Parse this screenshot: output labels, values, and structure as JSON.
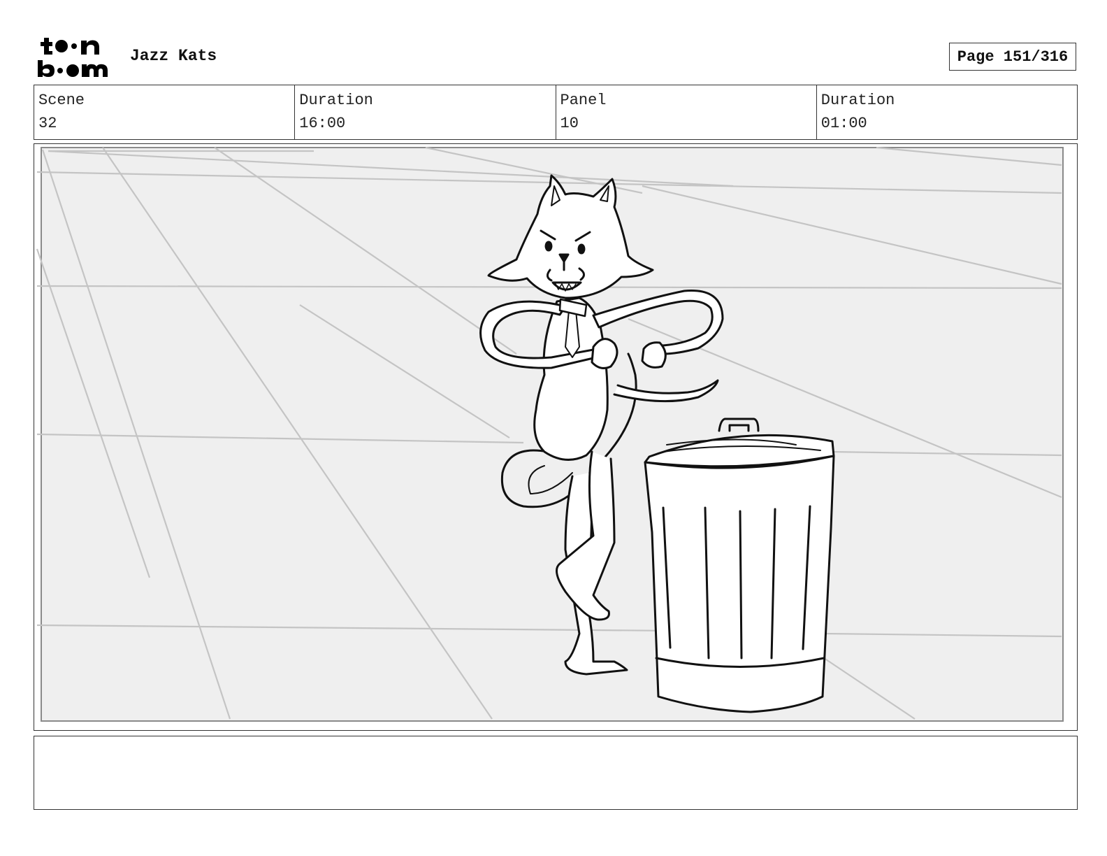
{
  "header": {
    "logo": {
      "icon": "toon-boom-logo",
      "text_line1": "toon",
      "text_line2": "boom"
    },
    "project_title": "Jazz Kats",
    "page_label": "Page 151/316"
  },
  "info": [
    {
      "label": "Scene",
      "value": "32"
    },
    {
      "label": "Duration",
      "value": "16:00"
    },
    {
      "label": "Panel",
      "value": "10"
    },
    {
      "label": "Duration",
      "value": "01:00"
    }
  ],
  "panel": {
    "image": "storyboard-sketch-cat-dancing-next-to-trash-can",
    "background_color": "#efefef",
    "line_color": "#c4c4c4"
  },
  "notes": {
    "text": ""
  }
}
